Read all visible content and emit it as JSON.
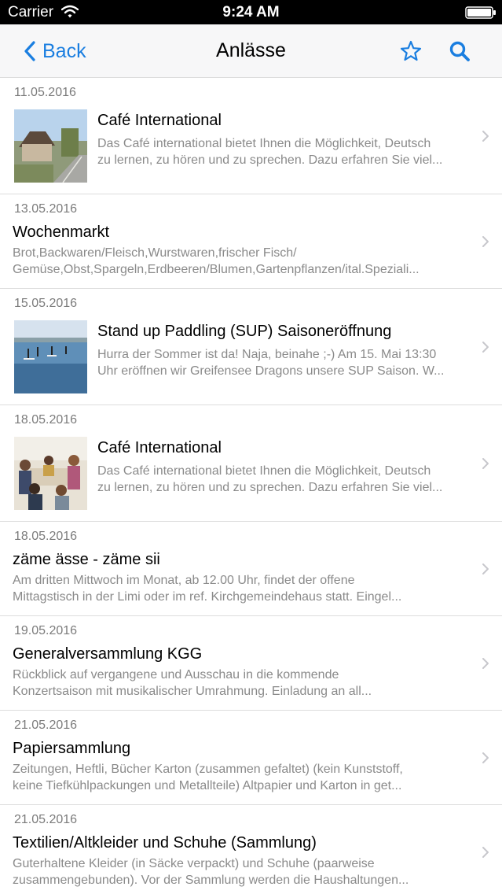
{
  "status_bar": {
    "carrier": "Carrier",
    "time": "9:24 AM"
  },
  "nav": {
    "back_label": "Back",
    "title": "Anlässe"
  },
  "events": [
    {
      "date": "11.05.2016",
      "title": "Café International",
      "desc_line1": "Das Café international bietet Ihnen die Möglichkeit, Deutsch",
      "desc_line2": "zu lernen, zu hören und zu sprechen. Dazu erfahren Sie viel..."
    },
    {
      "date": "13.05.2016",
      "title": "Wochenmarkt",
      "desc_line1": "Brot,Backwaren/Fleisch,Wurstwaren,frischer Fisch/",
      "desc_line2": "Gemüse,Obst,Spargeln,Erdbeeren/Blumen,Gartenpflanzen/ital.Speziali..."
    },
    {
      "date": "15.05.2016",
      "title": "Stand up Paddling (SUP) Saisoneröffnung",
      "desc_line1": "Hurra der Sommer ist da! Naja, beinahe ;-) Am 15. Mai 13:30",
      "desc_line2": "Uhr eröffnen wir Greifensee Dragons unsere SUP Saison. W..."
    },
    {
      "date": "18.05.2016",
      "title": "Café International",
      "desc_line1": "Das Café international bietet Ihnen die Möglichkeit, Deutsch",
      "desc_line2": "zu lernen, zu hören und zu sprechen. Dazu erfahren Sie viel..."
    },
    {
      "date": "18.05.2016",
      "title": "zäme ässe - zäme sii",
      "desc_line1": "Am dritten Mittwoch im Monat, ab 12.00 Uhr, findet der offene",
      "desc_line2": "Mittagstisch in der Limi oder im ref. Kirchgemeindehaus statt. Eingel..."
    },
    {
      "date": "19.05.2016",
      "title": "Generalversammlung KGG",
      "desc_line1": "Rückblick auf vergangene und Ausschau in die kommende",
      "desc_line2": "Konzertsaison mit musikalischer Umrahmung. Einladung an all..."
    },
    {
      "date": "21.05.2016",
      "title": "Papiersammlung",
      "desc_line1": "Zeitungen, Heftli, Bücher  Karton (zusammen gefaltet)  (kein Kunststoff,",
      "desc_line2": "keine Tiefkühlpackungen und Metallteile)   Altpapier und Karton in get..."
    },
    {
      "date": "21.05.2016",
      "title": "Textilien/Altkleider und Schuhe (Sammlung)",
      "desc_line1": "Guterhaltene Kleider (in Säcke verpackt) und Schuhe (paarweise",
      "desc_line2": "zusammengebunden). Vor der Sammlung werden die Haushaltungen..."
    }
  ],
  "colors": {
    "accent": "#1a7ee0",
    "date_text": "#7b7b7b",
    "desc_text": "#8a8a8a",
    "nav_bg": "#f7f7f8"
  },
  "icons": {
    "back": "chevron-left-icon",
    "favorite": "star-icon",
    "search": "search-icon",
    "row_disclosure": "chevron-right-icon"
  }
}
